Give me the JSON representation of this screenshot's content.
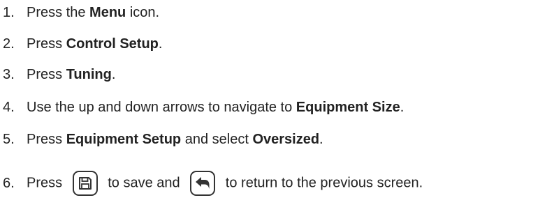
{
  "steps": [
    {
      "number": "1.",
      "parts": [
        "Press the ",
        "Menu",
        " icon."
      ]
    },
    {
      "number": "2.",
      "parts": [
        "Press ",
        "Control Setup",
        "."
      ]
    },
    {
      "number": "3.",
      "parts": [
        "Press ",
        "Tuning",
        "."
      ]
    },
    {
      "number": "4.",
      "parts": [
        "Use the up and down arrows to navigate to ",
        "Equipment Size",
        "."
      ]
    },
    {
      "number": "5.",
      "parts": [
        "Press ",
        "Equipment Setup",
        " and select ",
        "Oversized",
        "."
      ]
    },
    {
      "number": "6.",
      "parts": [
        "Press",
        "to save and",
        "to return to the previous screen."
      ]
    }
  ],
  "icons": {
    "save": "save-icon",
    "back": "back-arrow-icon"
  }
}
